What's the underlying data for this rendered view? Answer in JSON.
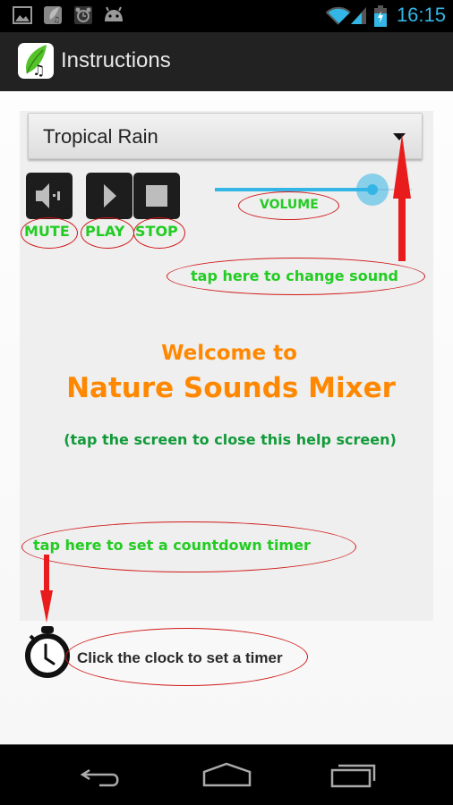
{
  "status_bar": {
    "icons": [
      "gallery-icon",
      "app-notification-icon",
      "alarm-icon",
      "android-icon",
      "wifi-icon",
      "signal-icon",
      "battery-charging-icon"
    ],
    "time": "16:15",
    "accent_color": "#33b5e5"
  },
  "action_bar": {
    "title": "Instructions",
    "app_icon": "leaf-music-icon"
  },
  "sound_selector": {
    "selected": "Tropical Rain"
  },
  "controls": {
    "mute_label": "MUTE",
    "play_label": "PLAY",
    "stop_label": "STOP",
    "volume_label": "VOLUME",
    "volume_percent": 80
  },
  "annotations": {
    "change_sound": "tap here to change sound",
    "countdown_timer": "tap here to set a countdown timer",
    "annotation_color": "#22cc22",
    "ellipse_color": "#d01818"
  },
  "welcome": {
    "line1": "Welcome to",
    "line2": "Nature Sounds Mixer",
    "close_hint": "(tap the screen to close this help screen)",
    "title_color": "#ff8800",
    "hint_color": "#129a3a"
  },
  "timer": {
    "text": "Click the clock to set a timer"
  },
  "nav_bar": {
    "buttons": [
      "back",
      "home",
      "recent-apps"
    ]
  }
}
